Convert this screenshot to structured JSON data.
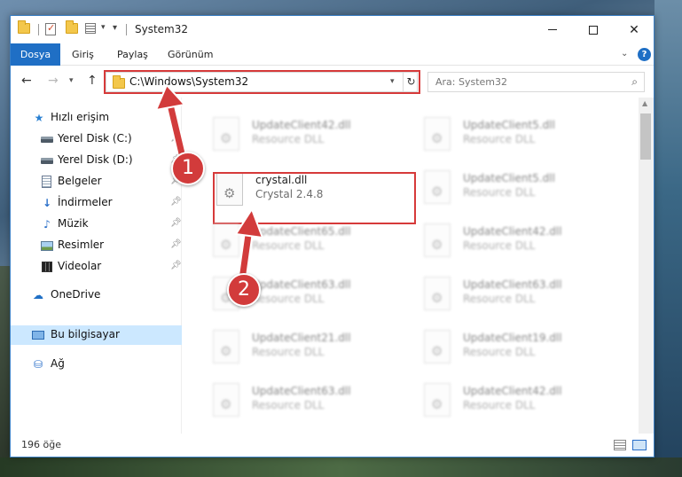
{
  "window": {
    "title": "System32",
    "buttons": {
      "minimize": "–",
      "maximize": "",
      "close": "✕"
    }
  },
  "ribbon": {
    "tabs": [
      {
        "label": "Dosya",
        "active": true
      },
      {
        "label": "Giriş"
      },
      {
        "label": "Paylaş"
      },
      {
        "label": "Görünüm"
      }
    ],
    "help": "?"
  },
  "navigation": {
    "address": "C:\\Windows\\System32",
    "search_placeholder": "Ara: System32"
  },
  "sidebar": {
    "items": [
      {
        "label": "Hızlı erişim",
        "icon": "star-icon"
      },
      {
        "label": "Yerel Disk (C:)",
        "icon": "drive-icon",
        "pinned": true
      },
      {
        "label": "Yerel Disk (D:)",
        "icon": "drive-icon",
        "pinned": true
      },
      {
        "label": "Belgeler",
        "icon": "documents-icon",
        "pinned": true
      },
      {
        "label": "İndirmeler",
        "icon": "download-icon",
        "pinned": true
      },
      {
        "label": "Müzik",
        "icon": "music-icon",
        "pinned": true
      },
      {
        "label": "Resimler",
        "icon": "pictures-icon",
        "pinned": true
      },
      {
        "label": "Videolar",
        "icon": "videos-icon",
        "pinned": true
      },
      {
        "label": "OneDrive",
        "icon": "cloud-icon"
      },
      {
        "label": "Bu bilgisayar",
        "icon": "computer-icon",
        "selected": true
      },
      {
        "label": "Ağ",
        "icon": "network-icon"
      }
    ]
  },
  "files": [
    {
      "name": "UpdateClient42.dll",
      "type": "Resource DLL",
      "blurred": true
    },
    {
      "name": "UpdateClient5.dll",
      "type": "Resource DLL",
      "blurred": true
    },
    {
      "name": "crystal.dll",
      "type": "Crystal 2.4.8",
      "blurred": false,
      "highlighted": true
    },
    {
      "name": "UpdateClient5.dll",
      "type": "Resource DLL",
      "blurred": true
    },
    {
      "name": "UpdateClient65.dll",
      "type": "Resource DLL",
      "blurred": true
    },
    {
      "name": "UpdateClient42.dll",
      "type": "Resource DLL",
      "blurred": true
    },
    {
      "name": "UpdateClient63.dll",
      "type": "Resource DLL",
      "blurred": true
    },
    {
      "name": "UpdateClient63.dll",
      "type": "Resource DLL",
      "blurred": true
    },
    {
      "name": "UpdateClient21.dll",
      "type": "Resource DLL",
      "blurred": true
    },
    {
      "name": "UpdateClient19.dll",
      "type": "Resource DLL",
      "blurred": true
    },
    {
      "name": "UpdateClient63.dll",
      "type": "Resource DLL",
      "blurred": true
    },
    {
      "name": "UpdateClient42.dll",
      "type": "Resource DLL",
      "blurred": true
    }
  ],
  "status": {
    "item_count": "196 öğe"
  },
  "annotations": {
    "badge1": "1",
    "badge2": "2",
    "color": "#d23b3b"
  }
}
